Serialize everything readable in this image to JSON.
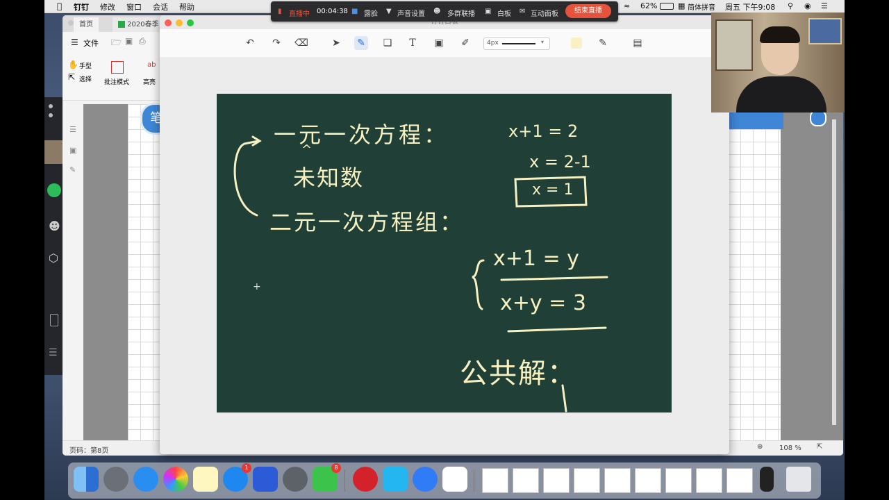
{
  "menubar": {
    "apple": "",
    "app_name": "钉钉",
    "menus": [
      "修改",
      "窗口",
      "会话",
      "帮助"
    ],
    "battery": "62%",
    "input_method": "简体拼音",
    "datetime": "周五 下午9:08"
  },
  "livebar": {
    "status": "直播中",
    "timer": "00:04:38",
    "face_label": "露脸",
    "audio_label": "声音设置",
    "multi_group": "多群联播",
    "whiteboard": "白板",
    "interactive": "互动面板",
    "end_button": "结束直播"
  },
  "pdf_viewer": {
    "tab_home": "首页",
    "tab_doc": "2020春季",
    "file_menu": "文件",
    "hand_tool": "手型",
    "select_tool": "选择",
    "annotate_mode": "批注模式",
    "highlight": "高亮",
    "page_status": "页码：第8页",
    "zoom": "108 %",
    "pen_badge": "笔"
  },
  "whiteboard": {
    "title": "钉钉白板",
    "stroke_size": "4px",
    "accent_color": "#fbefc4",
    "board_color": "#203f37",
    "ink_color": "#f7f1c2"
  },
  "board_text": {
    "line1": "一元一次方程：",
    "line1_hat": "^",
    "line2": "未知数",
    "line3": "二元一次方程组：",
    "eq1": "x+1 = 2",
    "eq2": "x = 2-1",
    "eq3": "x = 1",
    "sys1": "x+1 = y",
    "sys2": "x+y = 3",
    "brace": "{",
    "common": "公共解：",
    "cursor": "+"
  },
  "dock": {
    "appstore_badge": "1",
    "wechat_badge": "8"
  }
}
